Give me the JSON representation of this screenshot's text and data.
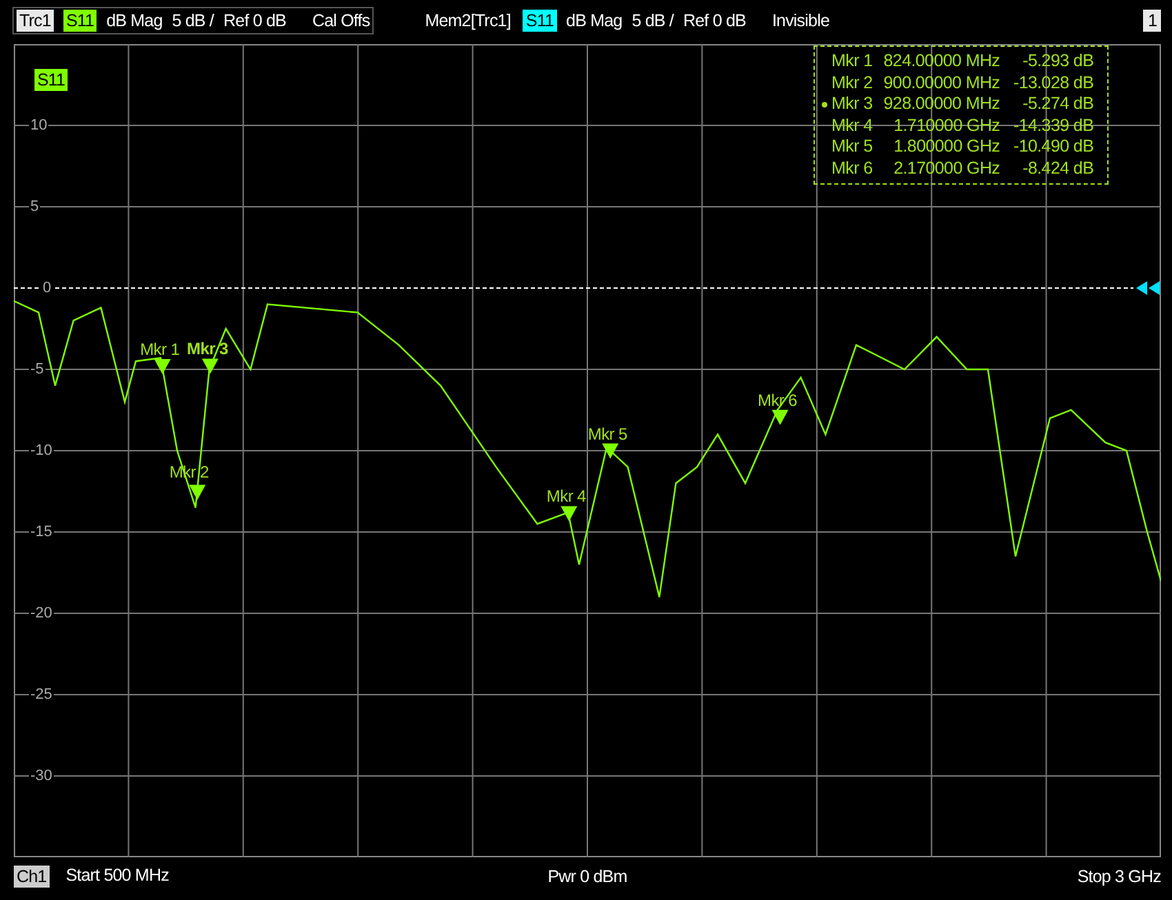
{
  "header": {
    "traces": [
      {
        "name": "Trc1",
        "param": "S11",
        "color": "#80ff00",
        "format": "dB Mag",
        "scale": "5 dB /",
        "ref": "Ref 0 dB",
        "status": "Cal Offs",
        "selected": true
      },
      {
        "name": "Mem2[Trc1]",
        "param": "S11",
        "color": "#00ffff",
        "format": "dB Mag",
        "scale": "5 dB /",
        "ref": "Ref 0 dB",
        "status": "Invisible",
        "selected": false
      }
    ],
    "window_number": "1"
  },
  "diagram": {
    "trace_label": "S11",
    "y_axis_labels": [
      "10",
      "5",
      "0",
      "-5",
      "-10",
      "-15",
      "-20",
      "-25",
      "-30"
    ],
    "marker_table": [
      {
        "label": "Mkr 1",
        "stimulus": "824.00000 MHz",
        "response": "-5.293 dB",
        "selected": false
      },
      {
        "label": "Mkr 2",
        "stimulus": "900.00000 MHz",
        "response": "-13.028 dB",
        "selected": false
      },
      {
        "label": "Mkr 3",
        "stimulus": "928.00000 MHz",
        "response": "-5.274 dB",
        "selected": true
      },
      {
        "label": "Mkr 4",
        "stimulus": "1.710000 GHz",
        "response": "-14.339 dB",
        "selected": false
      },
      {
        "label": "Mkr 5",
        "stimulus": "1.800000 GHz",
        "response": "-10.490 dB",
        "selected": false
      },
      {
        "label": "Mkr 6",
        "stimulus": "2.170000 GHz",
        "response": "-8.424 dB",
        "selected": false
      }
    ],
    "marker_labels": [
      "Mkr 1",
      "Mkr 2",
      "Mkr 3",
      "Mkr 4",
      "Mkr 5",
      "Mkr 6"
    ]
  },
  "footer": {
    "channel": "Ch1",
    "start": "Start 500 MHz",
    "power": "Pwr 0 dBm",
    "stop": "Stop 3 GHz"
  }
}
